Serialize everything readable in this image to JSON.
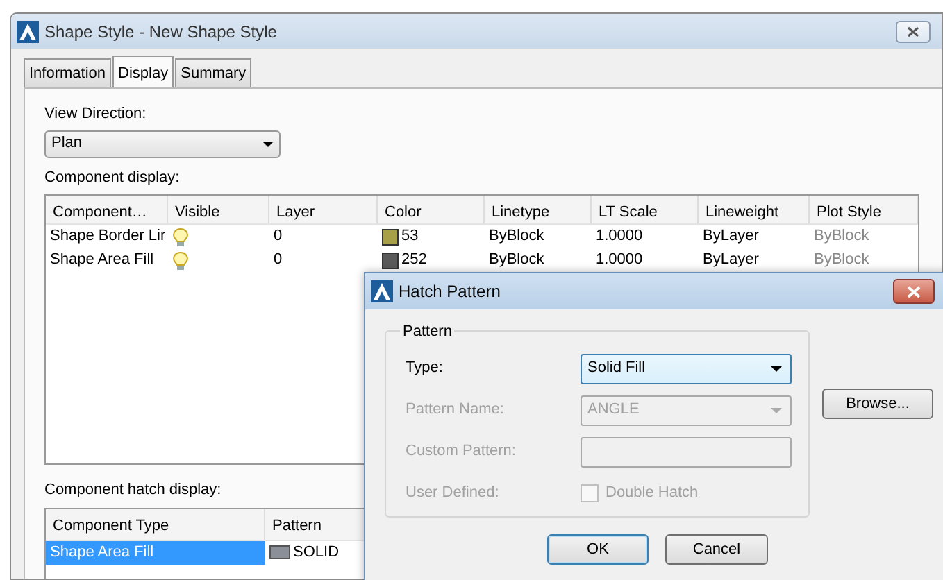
{
  "window": {
    "title": "Shape Style - New Shape Style"
  },
  "tabs": [
    {
      "label": "Information",
      "selected": false
    },
    {
      "label": "Display",
      "selected": true
    },
    {
      "label": "Summary",
      "selected": false
    }
  ],
  "view_direction": {
    "label": "View Direction:",
    "value": "Plan"
  },
  "component_display": {
    "label": "Component display:",
    "columns": [
      "Component…",
      "Visible",
      "Layer",
      "Color",
      "Linetype",
      "LT Scale",
      "Lineweight",
      "Plot Style"
    ],
    "rows": [
      {
        "component": "Shape Border Lir",
        "visible": true,
        "layer": "0",
        "color": "#a8a048",
        "color_text": "53",
        "linetype": "ByBlock",
        "lt_scale": "1.0000",
        "lineweight": "ByLayer",
        "plot_style": "ByBlock"
      },
      {
        "component": "Shape Area Fill",
        "visible": true,
        "layer": "0",
        "color": "#5a5a5a",
        "color_text": "252",
        "linetype": "ByBlock",
        "lt_scale": "1.0000",
        "lineweight": "ByLayer",
        "plot_style": "ByBlock"
      }
    ]
  },
  "hatch_display": {
    "label": "Component hatch display:",
    "columns": [
      "Component Type",
      "Pattern"
    ],
    "rows": [
      {
        "component_type": "Shape Area Fill",
        "pattern": "SOLID",
        "selected": true
      }
    ]
  },
  "hatch_dialog": {
    "title": "Hatch Pattern",
    "group": "Pattern",
    "fields": [
      {
        "kind": "select",
        "label": "Type:",
        "value": "Solid Fill",
        "disabled": false
      },
      {
        "kind": "select",
        "label": "Pattern Name:",
        "value": "ANGLE",
        "disabled": true
      },
      {
        "kind": "text",
        "label": "Custom Pattern:",
        "disabled": true
      },
      {
        "kind": "checkbox",
        "label": "User Defined:",
        "value": "Double Hatch",
        "checked": false,
        "disabled": true
      }
    ],
    "browse": "Browse...",
    "ok": "OK",
    "cancel": "Cancel"
  }
}
